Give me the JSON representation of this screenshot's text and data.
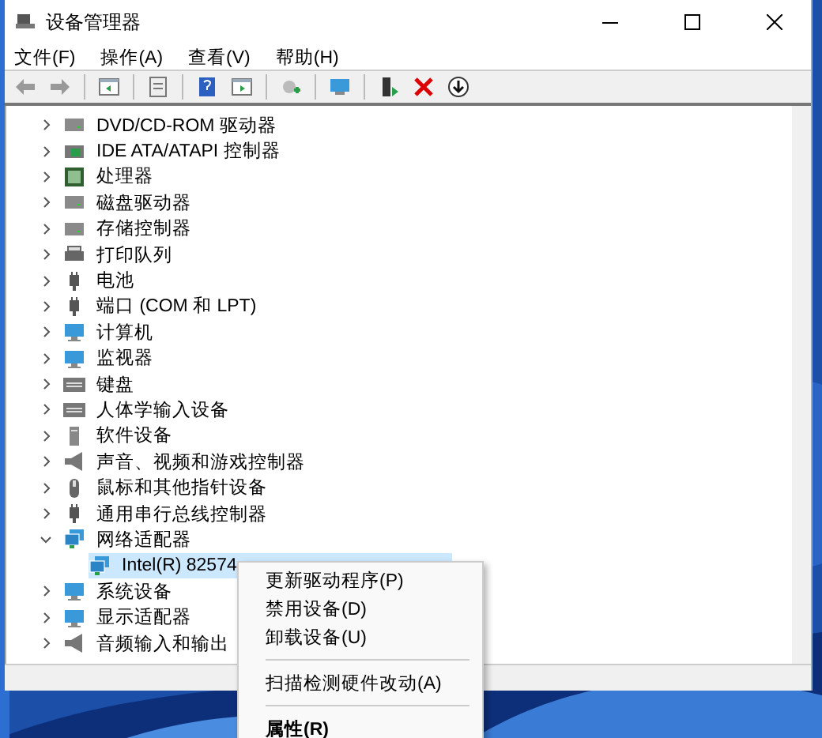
{
  "window": {
    "title": "设备管理器"
  },
  "menu_bar": [
    "文件(F)",
    "操作(A)",
    "查看(V)",
    "帮助(H)"
  ],
  "tree": [
    {
      "label": "DVD/CD-ROM 驱动器",
      "expanded": false
    },
    {
      "label": "IDE ATA/ATAPI 控制器",
      "expanded": false
    },
    {
      "label": "处理器",
      "expanded": false
    },
    {
      "label": "磁盘驱动器",
      "expanded": false
    },
    {
      "label": "存储控制器",
      "expanded": false
    },
    {
      "label": "打印队列",
      "expanded": false
    },
    {
      "label": "电池",
      "expanded": false
    },
    {
      "label": "端口 (COM 和 LPT)",
      "expanded": false
    },
    {
      "label": "计算机",
      "expanded": false
    },
    {
      "label": "监视器",
      "expanded": false
    },
    {
      "label": "键盘",
      "expanded": false
    },
    {
      "label": "人体学输入设备",
      "expanded": false
    },
    {
      "label": "软件设备",
      "expanded": false
    },
    {
      "label": "声音、视频和游戏控制器",
      "expanded": false
    },
    {
      "label": "鼠标和其他指针设备",
      "expanded": false
    },
    {
      "label": "通用串行总线控制器",
      "expanded": false
    },
    {
      "label": "网络适配器",
      "expanded": true,
      "children": [
        {
          "label": "Intel(R) 82574",
          "selected": true
        }
      ]
    },
    {
      "label": "系统设备",
      "expanded": false
    },
    {
      "label": "显示适配器",
      "expanded": false
    },
    {
      "label": "音频输入和输出",
      "expanded": false
    }
  ],
  "context_menu": [
    {
      "kind": "item",
      "label": "更新驱动程序(P)",
      "default": false
    },
    {
      "kind": "item",
      "label": "禁用设备(D)",
      "default": false
    },
    {
      "kind": "item",
      "label": "卸载设备(U)",
      "default": false
    },
    {
      "kind": "separator"
    },
    {
      "kind": "item",
      "label": "扫描检测硬件改动(A)",
      "default": false
    },
    {
      "kind": "separator"
    },
    {
      "kind": "item",
      "label": "属性(R)",
      "default": true
    }
  ]
}
